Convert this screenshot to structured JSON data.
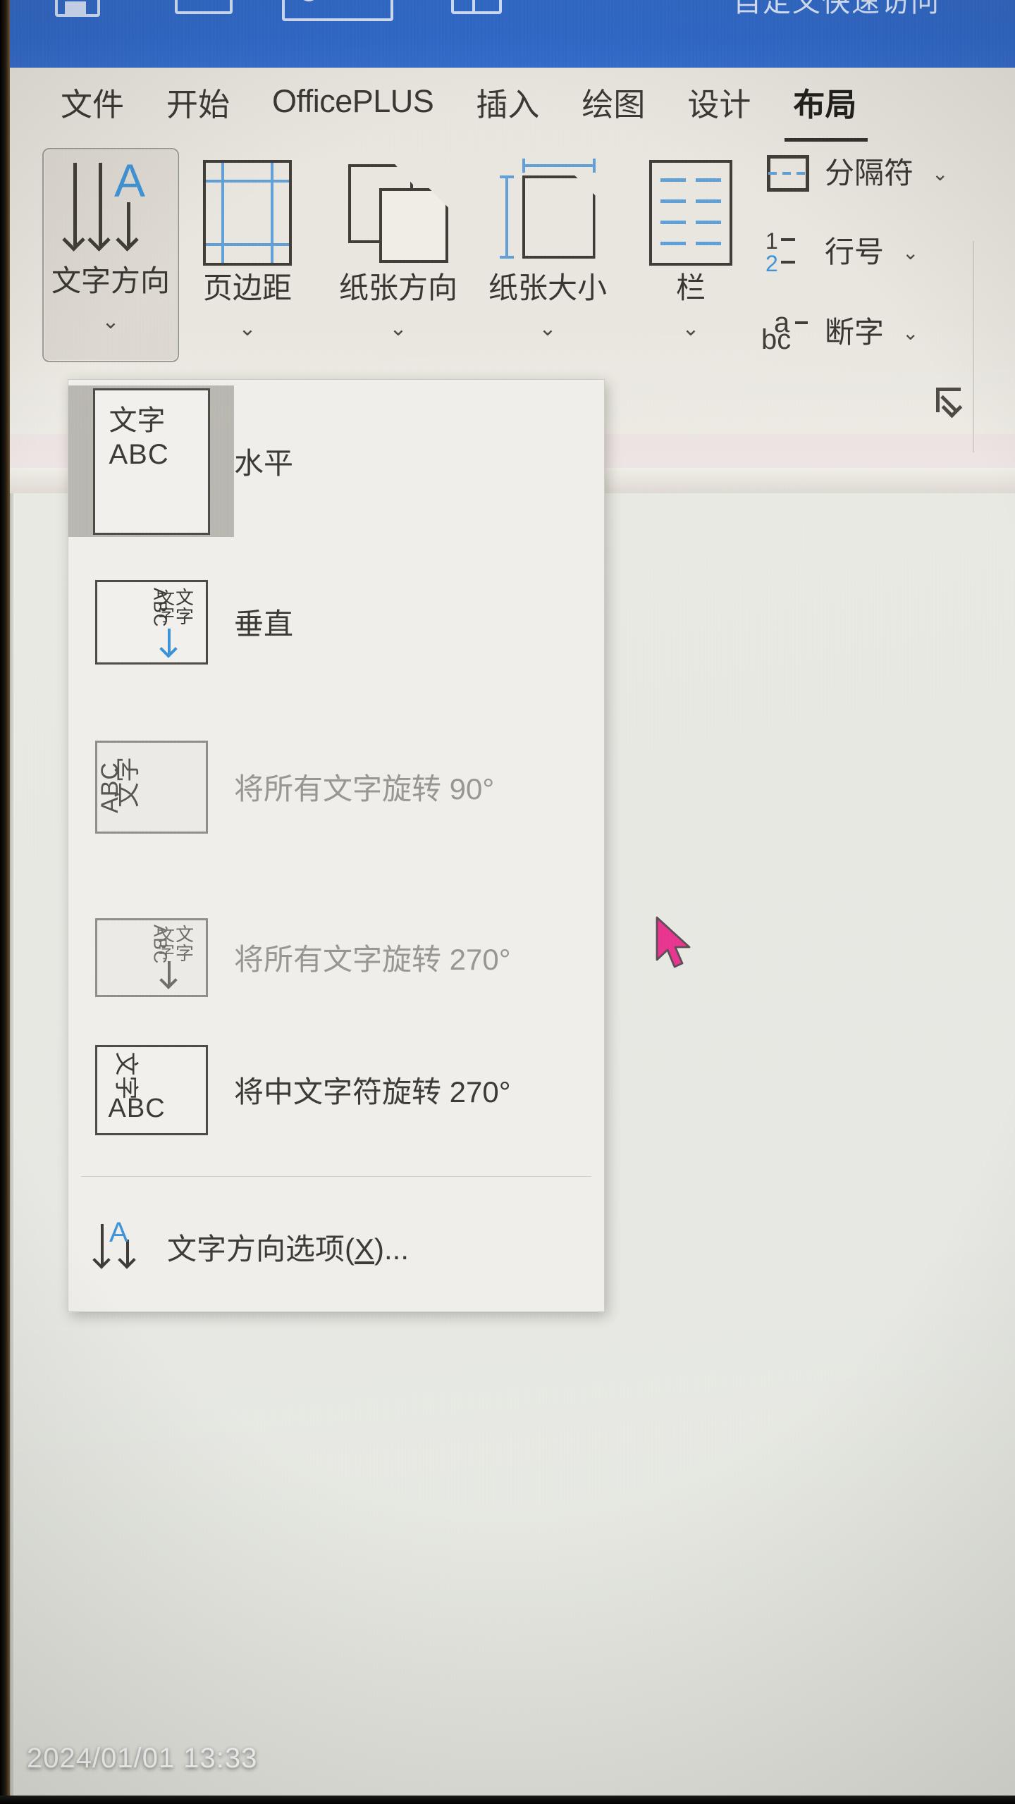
{
  "app": {
    "quick_access": {
      "icons": [
        "save-icon",
        "undo-icon",
        "autosave-toggle-icon",
        "window-icon"
      ],
      "right_text": "自定义快速访问"
    },
    "tabs": [
      {
        "label": "文件",
        "active": false
      },
      {
        "label": "开始",
        "active": false
      },
      {
        "label": "OfficePLUS",
        "active": false
      },
      {
        "label": "插入",
        "active": false
      },
      {
        "label": "绘图",
        "active": false
      },
      {
        "label": "设计",
        "active": false
      },
      {
        "label": "布局",
        "active": true
      }
    ]
  },
  "ribbon": {
    "large_commands": [
      {
        "label": "文字方向",
        "icon": "text-direction-icon",
        "has_dropdown": true,
        "pressed": true
      },
      {
        "label": "页边距",
        "icon": "margins-icon",
        "has_dropdown": true,
        "pressed": false
      },
      {
        "label": "纸张方向",
        "icon": "orientation-icon",
        "has_dropdown": true,
        "pressed": false
      },
      {
        "label": "纸张大小",
        "icon": "paper-size-icon",
        "has_dropdown": true,
        "pressed": false
      },
      {
        "label": "栏",
        "icon": "columns-icon",
        "has_dropdown": true,
        "pressed": false
      }
    ],
    "small_commands": [
      {
        "label": "分隔符",
        "icon": "breaks-icon",
        "has_dropdown": true
      },
      {
        "label": "行号",
        "icon": "line-numbers-icon",
        "has_dropdown": true
      },
      {
        "label": "断字",
        "icon": "hyphenation-icon",
        "has_dropdown": true
      }
    ],
    "dialog_launcher": "dialog-launcher-icon",
    "chevron_glyph": "⌄"
  },
  "dropdown": {
    "items": [
      {
        "label": "水平",
        "selected": true,
        "disabled": false,
        "thumb": "horizontal-thumb",
        "thumb_lines": [
          "文字",
          "ABC"
        ]
      },
      {
        "label": "垂直",
        "selected": false,
        "disabled": false,
        "thumb": "vertical-thumb",
        "thumb_lines": [
          "文字",
          "文字",
          "ABC"
        ]
      },
      {
        "label": "将所有文字旋转 90°",
        "selected": false,
        "disabled": true,
        "thumb": "rotate-90-thumb",
        "thumb_lines": [
          "文字",
          "ABC"
        ]
      },
      {
        "label": "将所有文字旋转 270°",
        "selected": false,
        "disabled": true,
        "thumb": "rotate-270-thumb",
        "thumb_lines": [
          "文字",
          "文字",
          "ABC"
        ]
      },
      {
        "label": "将中文字符旋转 270°",
        "selected": false,
        "disabled": false,
        "thumb": "rotate-cjk-270-thumb",
        "thumb_lines": [
          "文字",
          "ABC"
        ]
      }
    ],
    "options_entry": {
      "label_before": "文字方向选项(",
      "accel": "X",
      "label_after": ")...",
      "icon": "text-direction-options-icon"
    }
  },
  "overlay": {
    "timestamp": "2024/01/01 13:33",
    "cursor": "mouse-pointer-magenta"
  },
  "colors": {
    "ribbon_blue": "#2b63c4",
    "accent_blue": "#3b8fd4",
    "cursor_magenta": "#e8338c",
    "selected_gray": "#b7b5ae"
  }
}
